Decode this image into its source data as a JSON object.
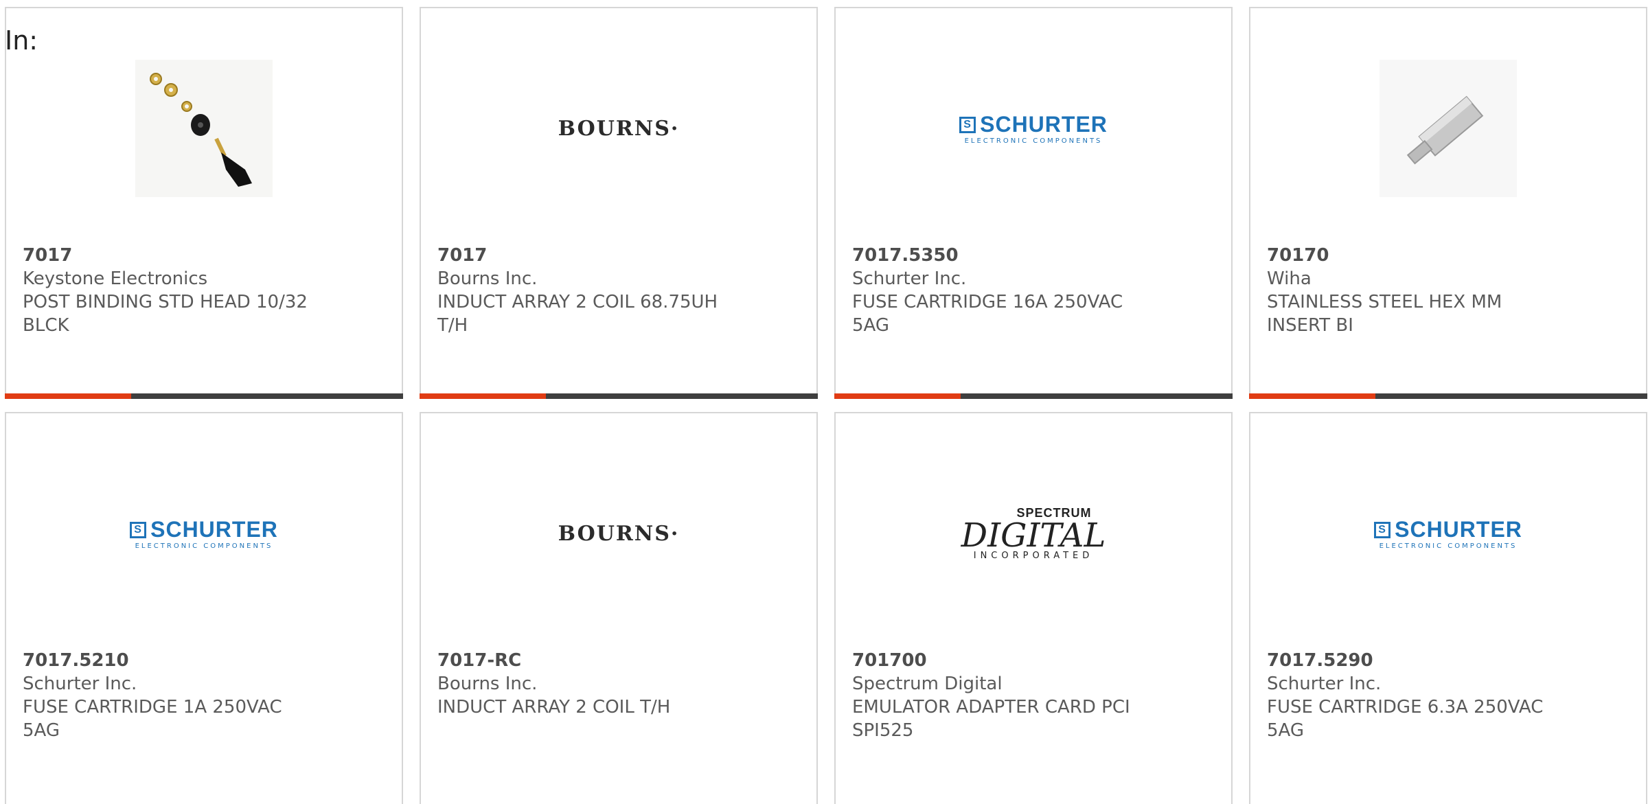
{
  "prefix_label": "In:",
  "colors": {
    "accent": "#e03c14",
    "bar": "#3f3f3f",
    "schurter_blue": "#1e73b8"
  },
  "cards": [
    {
      "part": "7017",
      "mfr": "Keystone Electronics",
      "desc_lines": [
        "POST BINDING STD HEAD 10/32",
        "BLCK"
      ],
      "image": "binding-post-photo",
      "logo_text": ""
    },
    {
      "part": "7017",
      "mfr": "Bourns Inc.",
      "desc_lines": [
        "INDUCT ARRAY 2 COIL 68.75UH",
        "T/H"
      ],
      "image": "bourns-logo",
      "logo_text": "BOURNS·"
    },
    {
      "part": "7017.5350",
      "mfr": "Schurter Inc.",
      "desc_lines": [
        "FUSE CARTRIDGE 16A 250VAC",
        "5AG"
      ],
      "image": "schurter-logo",
      "logo_text": "SCHURTER",
      "logo_sub": "ELECTRONIC COMPONENTS"
    },
    {
      "part": "70170",
      "mfr": "Wiha",
      "desc_lines": [
        "STAINLESS STEEL HEX MM",
        "INSERT BI"
      ],
      "image": "hex-bit-photo",
      "logo_text": ""
    },
    {
      "part": "7017.5210",
      "mfr": "Schurter Inc.",
      "desc_lines": [
        "FUSE CARTRIDGE 1A 250VAC",
        "5AG"
      ],
      "image": "schurter-logo",
      "logo_text": "SCHURTER",
      "logo_sub": "ELECTRONIC COMPONENTS"
    },
    {
      "part": "7017-RC",
      "mfr": "Bourns Inc.",
      "desc_lines": [
        "INDUCT ARRAY 2 COIL T/H"
      ],
      "image": "bourns-logo",
      "logo_text": "BOURNS·"
    },
    {
      "part": "701700",
      "mfr": "Spectrum Digital",
      "desc_lines": [
        "EMULATOR ADAPTER CARD PCI",
        "SPI525"
      ],
      "image": "spectrum-digital-logo",
      "logo_text": "SPECTRUM",
      "logo_mid": "DIGITAL",
      "logo_sub": "INCORPORATED"
    },
    {
      "part": "7017.5290",
      "mfr": "Schurter Inc.",
      "desc_lines": [
        "FUSE CARTRIDGE 6.3A 250VAC",
        "5AG"
      ],
      "image": "schurter-logo",
      "logo_text": "SCHURTER",
      "logo_sub": "ELECTRONIC COMPONENTS"
    }
  ]
}
